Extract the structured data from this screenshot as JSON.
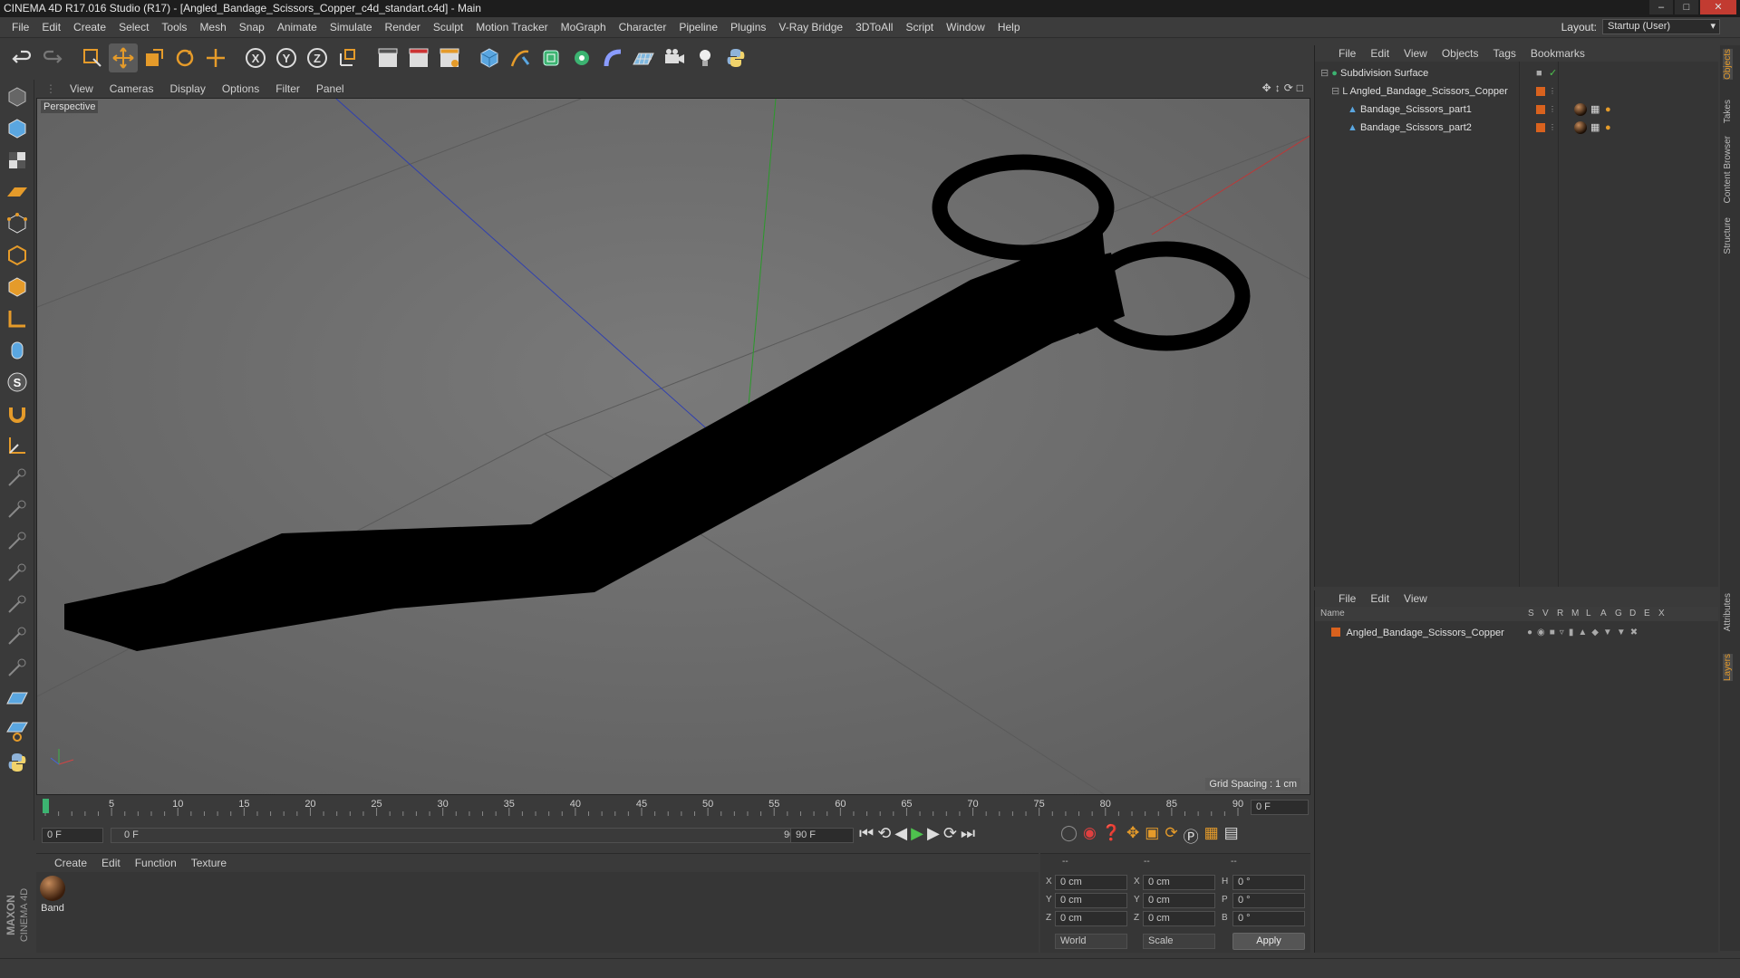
{
  "window": {
    "title": "CINEMA 4D R17.016 Studio (R17) - [Angled_Bandage_Scissors_Copper_c4d_standart.c4d] - Main"
  },
  "menubar": [
    "File",
    "Edit",
    "Create",
    "Select",
    "Tools",
    "Mesh",
    "Snap",
    "Animate",
    "Simulate",
    "Render",
    "Sculpt",
    "Motion Tracker",
    "MoGraph",
    "Character",
    "Pipeline",
    "Plugins",
    "V-Ray Bridge",
    "3DToAll",
    "Script",
    "Window",
    "Help"
  ],
  "layout": {
    "label": "Layout:",
    "value": "Startup (User)"
  },
  "viewport": {
    "menu": [
      "View",
      "Cameras",
      "Display",
      "Options",
      "Filter",
      "Panel"
    ],
    "label": "Perspective",
    "grid_spacing": "Grid Spacing : 1 cm"
  },
  "timeline": {
    "ticks": [
      "0",
      "5",
      "10",
      "15",
      "20",
      "25",
      "30",
      "35",
      "40",
      "45",
      "50",
      "55",
      "60",
      "65",
      "70",
      "75",
      "80",
      "85",
      "90"
    ],
    "frame_field": "0 F",
    "start_field": "0 F",
    "range_start": "0 F",
    "range_end": "90 F",
    "end_field": "90 F"
  },
  "material_manager": {
    "menu": [
      "Create",
      "Edit",
      "Function",
      "Texture"
    ],
    "materials": [
      {
        "name": "Band"
      }
    ]
  },
  "coordinates": {
    "headers": [
      "--",
      "--",
      "--"
    ],
    "rows": [
      {
        "a": "X",
        "av": "0 cm",
        "b": "X",
        "bv": "0 cm",
        "c": "H",
        "cv": "0 °"
      },
      {
        "a": "Y",
        "av": "0 cm",
        "b": "Y",
        "bv": "0 cm",
        "c": "P",
        "cv": "0 °"
      },
      {
        "a": "Z",
        "av": "0 cm",
        "b": "Z",
        "bv": "0 cm",
        "c": "B",
        "cv": "0 °"
      }
    ],
    "space": "World",
    "mode": "Scale",
    "apply": "Apply"
  },
  "object_manager": {
    "menu": [
      "File",
      "Edit",
      "View",
      "Objects",
      "Tags",
      "Bookmarks"
    ],
    "objects": [
      {
        "name": "Subdivision Surface"
      },
      {
        "name": "Angled_Bandage_Scissors_Copper"
      },
      {
        "name": "Bandage_Scissors_part1"
      },
      {
        "name": "Bandage_Scissors_part2"
      }
    ]
  },
  "layer_manager": {
    "menu": [
      "File",
      "Edit",
      "View"
    ],
    "columns": [
      "Name",
      "S",
      "V",
      "R",
      "M",
      "L",
      "A",
      "G",
      "D",
      "E",
      "X"
    ],
    "layers": [
      {
        "name": "Angled_Bandage_Scissors_Copper",
        "color": "#d9621e"
      }
    ]
  },
  "right_tabs": [
    "Objects",
    "Takes",
    "Content Browser",
    "Structure",
    "Attributes",
    "Layers"
  ],
  "brand": {
    "maxon": "MAXON",
    "product": "CINEMA 4D"
  },
  "colors": {
    "accent": "#e59b2a",
    "viewport_bg": "#6e6e6e",
    "layer_orange": "#d9621e",
    "play_green": "#4ec24e"
  }
}
